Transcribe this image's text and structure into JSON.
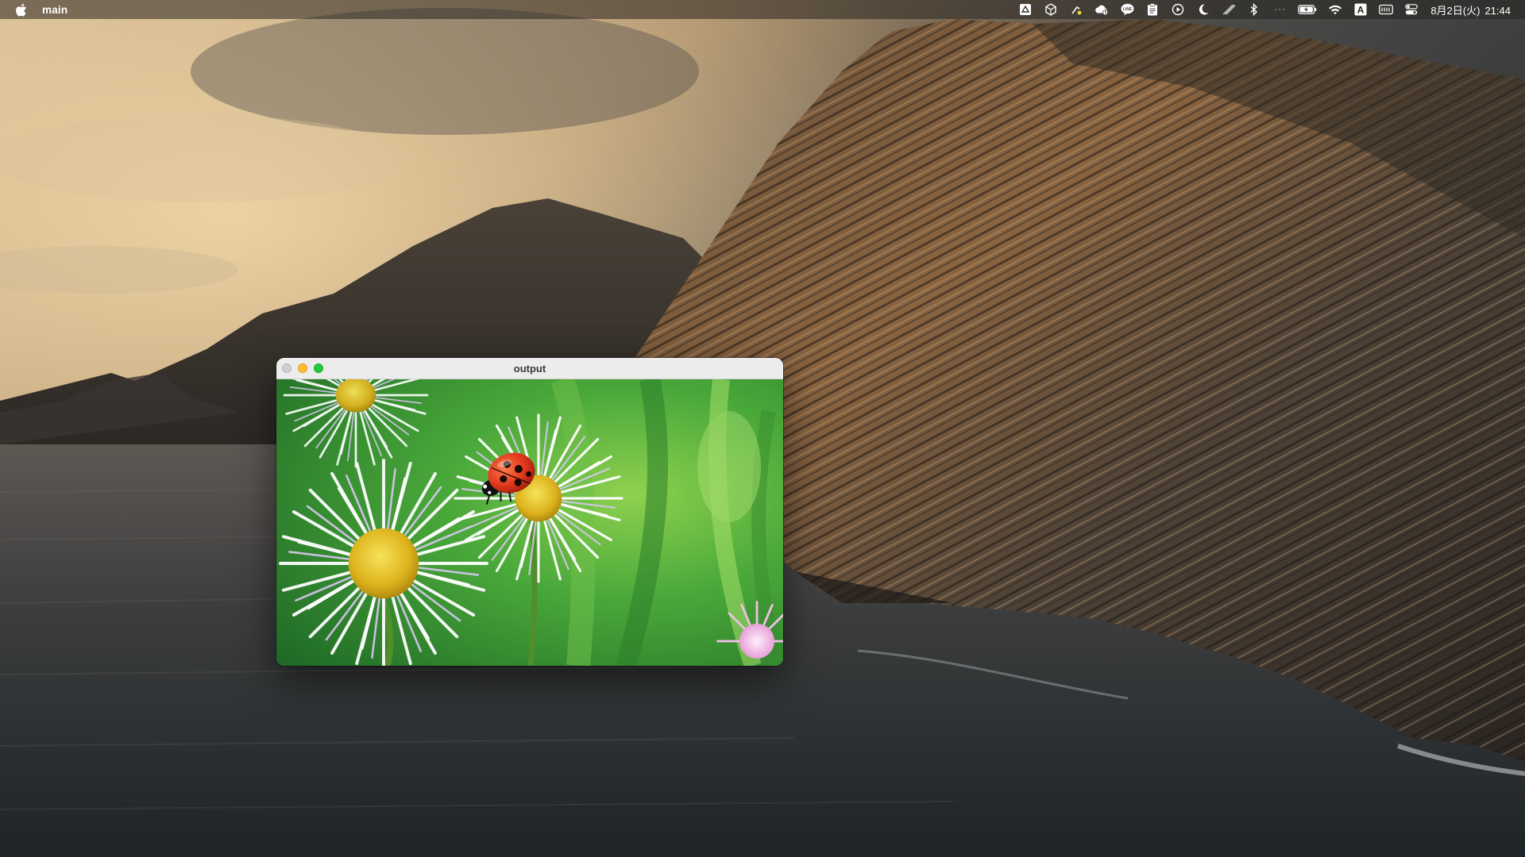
{
  "menubar": {
    "app_name": "main",
    "icons": [
      "apple-icon",
      "drive-icon",
      "box-icon",
      "lamp-icon",
      "cloud-icon",
      "line-chat-icon",
      "clipboard-icon",
      "play-icon",
      "moon-icon",
      "pen-icon",
      "bluetooth-icon",
      "dots-icon",
      "battery-icon",
      "wifi-icon",
      "input-method-icon",
      "keyboard-icon",
      "control-center-icon"
    ],
    "input_method_label": "A",
    "date": "8月2日(火)",
    "time": "21:44"
  },
  "window": {
    "title": "output",
    "content_image": "ladybug-on-white-daisy-photo"
  },
  "colors": {
    "close": "#cfcfcf",
    "minimize": "#febc2e",
    "zoom": "#28c840"
  }
}
